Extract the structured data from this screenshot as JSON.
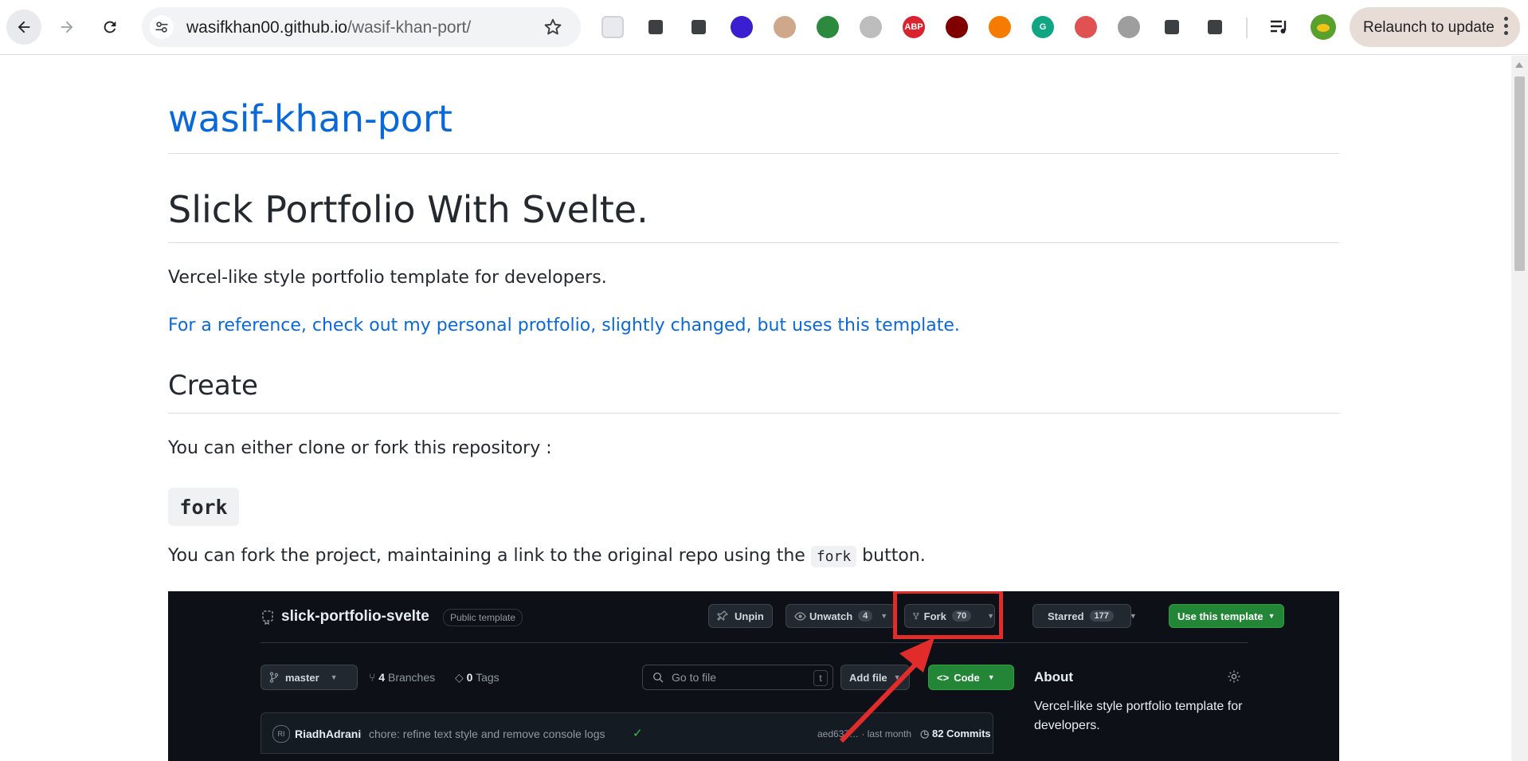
{
  "browser": {
    "url_host": "wasifkhan00.github.io",
    "url_path": "/wasif-khan-port/",
    "relaunch_label": "Relaunch to update",
    "extensions": [
      {
        "name": "ext-1-icon",
        "color": "#e8eaed",
        "text": ""
      },
      {
        "name": "ext-2-icon",
        "color": "#ffffff",
        "text": ""
      },
      {
        "name": "ext-3-icon",
        "color": "#ffffff",
        "text": ""
      },
      {
        "name": "ext-4-icon",
        "color": "#3a1fd1",
        "text": ""
      },
      {
        "name": "ext-5-icon",
        "color": "#cfa88c",
        "text": ""
      },
      {
        "name": "ext-6-icon",
        "color": "#2b8a3e",
        "text": ""
      },
      {
        "name": "ext-7-icon",
        "color": "#bdbdbd",
        "text": ""
      },
      {
        "name": "adblock-plus-icon",
        "color": "#d9232f",
        "text": "ABP"
      },
      {
        "name": "ublock-origin-icon",
        "color": "#800000",
        "text": ""
      },
      {
        "name": "ext-10-icon",
        "color": "#f57c00",
        "text": ""
      },
      {
        "name": "grammarly-icon",
        "color": "#11a683",
        "text": "G"
      },
      {
        "name": "ext-12-icon",
        "color": "#e05252",
        "text": ""
      },
      {
        "name": "ext-13-icon",
        "color": "#9e9e9e",
        "text": ""
      },
      {
        "name": "reply-icon",
        "color": "#ffffff",
        "text": ""
      },
      {
        "name": "extensions-puzzle-icon",
        "color": "#ffffff",
        "text": ""
      }
    ]
  },
  "page": {
    "repo_title": "wasif-khan-port",
    "heading": "Slick Portfolio With Svelte.",
    "description": "Vercel-like style portfolio template for developers.",
    "reference_link": "For a reference, check out my personal protfolio, slightly changed, but uses this template.",
    "create_heading": "Create",
    "create_text": "You can either clone or fork this repository :",
    "fork_heading": "fork",
    "fork_text_before": "You can fork the project, maintaining a link to the original repo using the",
    "fork_code": "fork",
    "fork_text_after": "button."
  },
  "github_shot": {
    "repo_name": "slick-portfolio-svelte",
    "badge": "Public template",
    "unpin": "Unpin",
    "unwatch": "Unwatch",
    "unwatch_count": "4",
    "fork": "Fork",
    "fork_count": "70",
    "starred": "Starred",
    "star_count": "177",
    "use_template": "Use this template",
    "branch": "master",
    "branches_count": "4",
    "branches_label": "Branches",
    "tags_count": "0",
    "tags_label": "Tags",
    "go_to_file": "Go to file",
    "go_to_file_key": "t",
    "add_file": "Add file",
    "code": "Code",
    "about_title": "About",
    "about_text_1": "Vercel-like style portfolio template for",
    "about_text_2": "developers.",
    "commit_avatar": "RI",
    "commit_author": "RiadhAdrani",
    "commit_message": "chore: refine text style and remove console logs",
    "commit_hash_time": "aed637… · last month",
    "commits_count": "82 Commits"
  }
}
